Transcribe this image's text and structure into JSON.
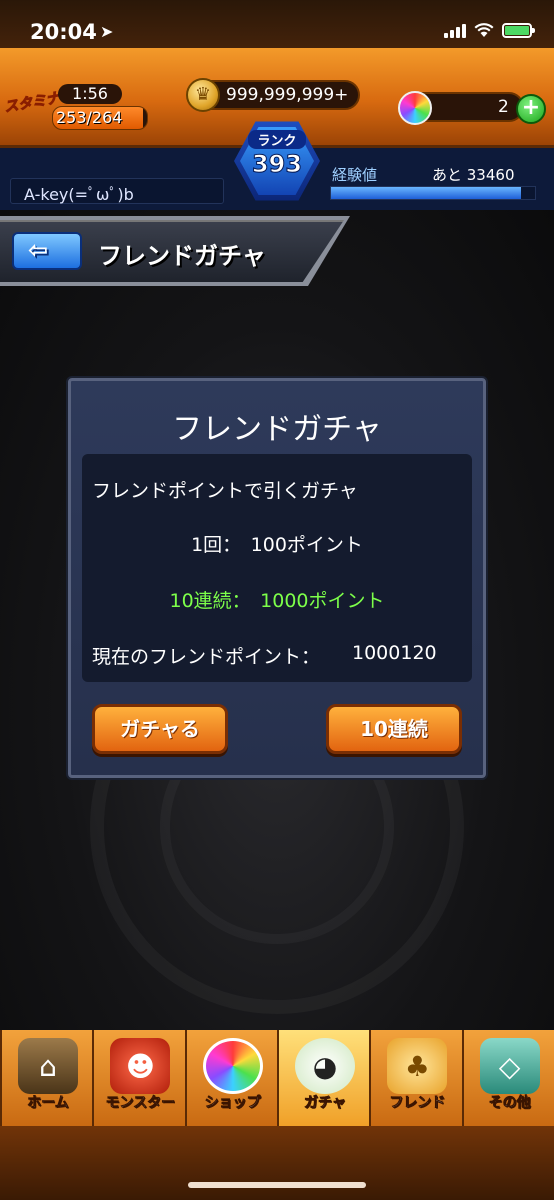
{
  "status_bar": {
    "time": "20:04",
    "location_icon": "location-arrow-icon"
  },
  "hud": {
    "stamina_label": "スタミナ",
    "stamina_timer": "1:56",
    "stamina_value": "253/264",
    "stamina_fraction": 0.958,
    "gold": "999,999,999+",
    "orbs": "2",
    "plus_label": "+"
  },
  "player": {
    "name": "A-key(=ﾟωﾟ)b",
    "rank_label": "ランク",
    "rank": "393",
    "exp_label": "経験値",
    "exp_remaining": "あと 33460",
    "exp_fraction": 0.93
  },
  "page": {
    "title": "フレンドガチャ",
    "back_icon": "back-arrow-icon"
  },
  "dialog": {
    "title": "フレンドガチャ",
    "description": "フレンドポイントで引くガチャ",
    "single_cost": "1回：　100ポイント",
    "multi_cost": "10連続：　1000ポイント",
    "current_points_label": "現在のフレンドポイント：",
    "current_points": "1000120",
    "button_single": "ガチャる",
    "button_multi": "10連続",
    "multi_color": "#7dff4a"
  },
  "nav": {
    "items": [
      {
        "label": "ホーム",
        "icon": "home-icon"
      },
      {
        "label": "モンスター",
        "icon": "monster-icon"
      },
      {
        "label": "ショップ",
        "icon": "shop-orb-icon"
      },
      {
        "label": "ガチャ",
        "icon": "gacha-egg-icon"
      },
      {
        "label": "フレンド",
        "icon": "friend-balloon-icon"
      },
      {
        "label": "その他",
        "icon": "other-map-icon"
      }
    ]
  }
}
